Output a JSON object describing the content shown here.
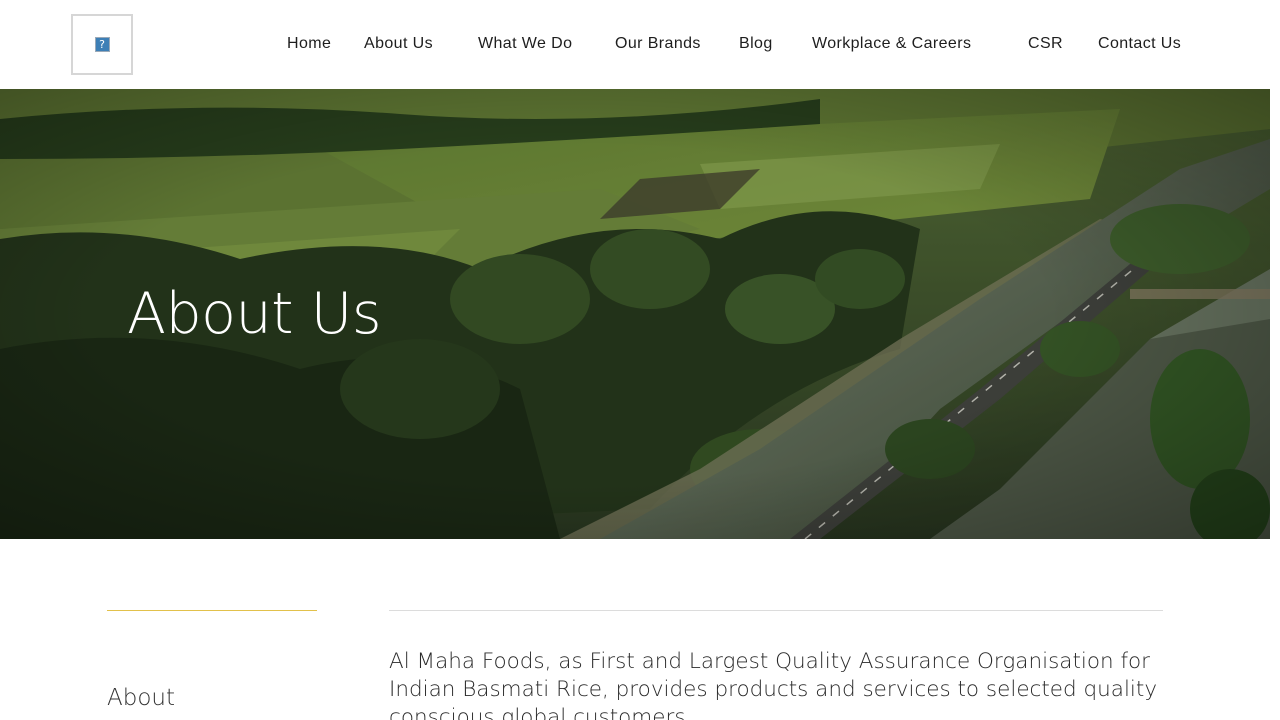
{
  "header": {
    "logo_glyph": "?",
    "nav": [
      {
        "label": "Home"
      },
      {
        "label": "About Us"
      },
      {
        "label": "What We Do"
      },
      {
        "label": "Our Brands"
      },
      {
        "label": "Blog"
      },
      {
        "label": "Workplace & Careers"
      },
      {
        "label": "CSR"
      },
      {
        "label": "Contact Us"
      }
    ]
  },
  "hero": {
    "title": "About Us"
  },
  "content": {
    "side_heading": "About",
    "intro": "Al Maha Foods, as First and Largest Quality Assurance Organisation for Indian Basmati Rice, provides products and services to selected quality conscious global customers."
  },
  "colors": {
    "accent_rule": "#e2c14b",
    "divider": "#dcdcdc",
    "header_bg": "#ffffff"
  },
  "icons": {
    "logo": "broken-image-icon"
  }
}
